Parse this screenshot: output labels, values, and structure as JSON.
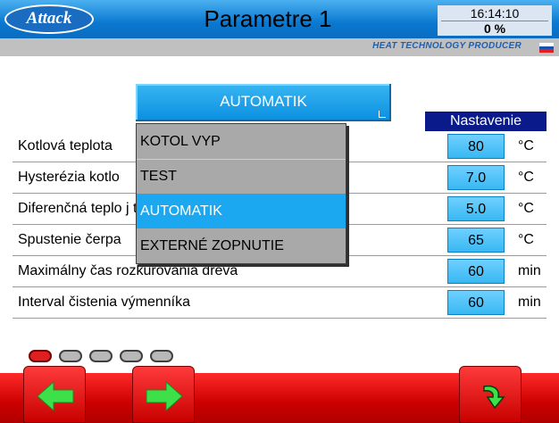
{
  "header": {
    "logo_text": "Attack",
    "title": "Parametre 1",
    "time": "16:14:10",
    "percent": "0  %",
    "tagline": "HEAT TECHNOLOGY PRODUCER",
    "colors": {
      "header_blue": "#0a78d0",
      "accent_cyan": "#38b8f2",
      "footer_red": "#cc0000"
    }
  },
  "mode": {
    "current": "AUTOMATIK",
    "options": [
      {
        "label": "KOTOL VYP",
        "selected": false
      },
      {
        "label": "TEST",
        "selected": false
      },
      {
        "label": "AUTOMATIK",
        "selected": true
      },
      {
        "label": "EXTERNÉ ZOPNUTIE",
        "selected": false
      }
    ]
  },
  "settings": {
    "header": "Nastavenie",
    "rows": [
      {
        "label": "Kotlová teplota",
        "value": "80",
        "unit": "°C"
      },
      {
        "label": "Hysterézia kotlo",
        "value": "7.0",
        "unit": "°C"
      },
      {
        "label": "Diferenčná teplo                                       j teploty",
        "value": "5.0",
        "unit": "°C"
      },
      {
        "label": "Spustenie čerpa",
        "value": "65",
        "unit": "°C"
      },
      {
        "label": "Maximálny čas rozkurovania dreva",
        "value": "60",
        "unit": "min"
      },
      {
        "label": "Interval čistenia výmenníka",
        "value": "60",
        "unit": "min"
      }
    ]
  },
  "pager": {
    "current_page": 1,
    "total_pages": 5
  },
  "footer": {
    "icons": [
      "arrow-left-icon",
      "arrow-right-icon",
      "return-icon"
    ]
  }
}
